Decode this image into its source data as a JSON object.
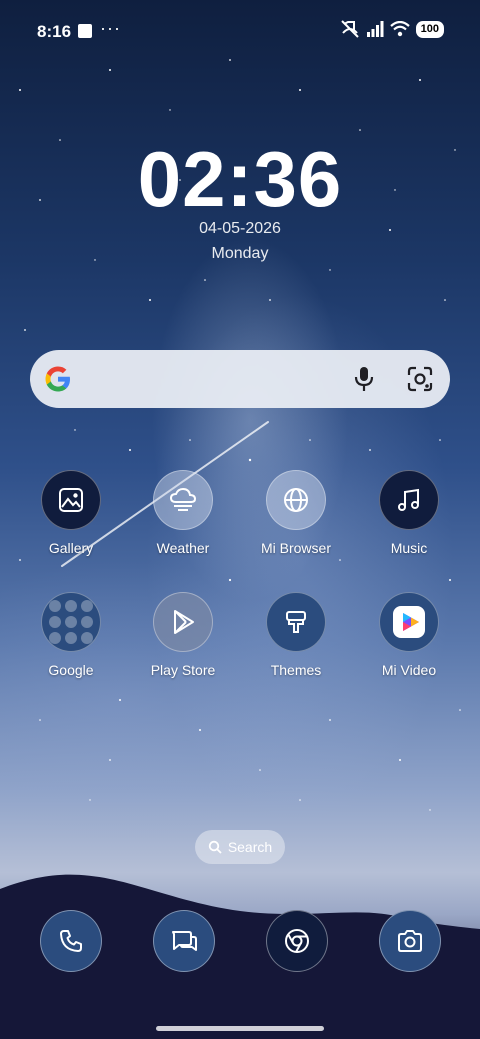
{
  "status_bar": {
    "time": "8:16",
    "more": "···",
    "battery": "100"
  },
  "lockclock": {
    "time": "02:36",
    "date": "04-05-2026",
    "day": "Monday"
  },
  "search_bar": {
    "icons": [
      "google-logo-icon",
      "mic-icon",
      "lens-icon"
    ]
  },
  "apps": [
    {
      "label": "Gallery",
      "icon": "gallery-icon"
    },
    {
      "label": "Weather",
      "icon": "weather-icon"
    },
    {
      "label": "Mi Browser",
      "icon": "globe-icon"
    },
    {
      "label": "Music",
      "icon": "music-note-icon"
    },
    {
      "label": "Google",
      "icon": "folder-icon"
    },
    {
      "label": "Play Store",
      "icon": "play-store-icon"
    },
    {
      "label": "Themes",
      "icon": "brush-icon"
    },
    {
      "label": "Mi Video",
      "icon": "mi-video-icon"
    }
  ],
  "search_pill": {
    "label": "Search"
  },
  "dock": [
    "phone-icon",
    "messages-icon",
    "chrome-icon",
    "camera-icon"
  ]
}
